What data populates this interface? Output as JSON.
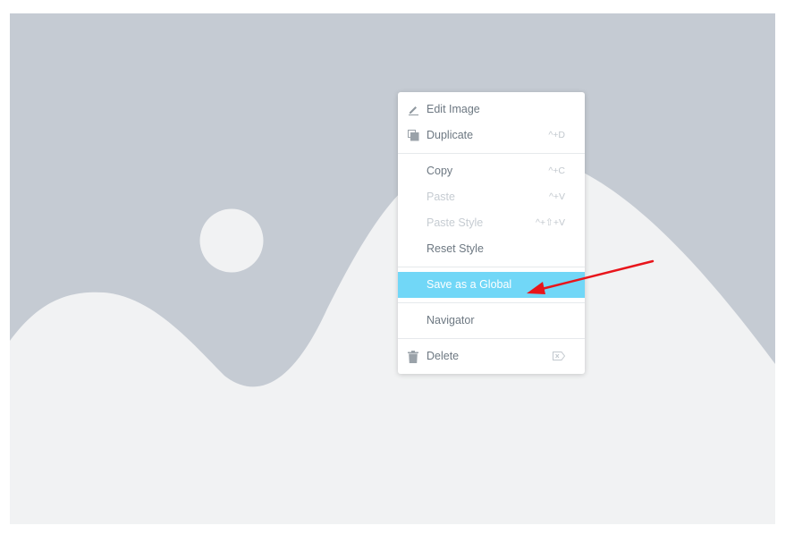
{
  "colors": {
    "canvas_background": "#ffffff",
    "placeholder_sky": "#c5cbd3",
    "placeholder_foreground": "#f1f2f3",
    "menu_text": "#6d7882",
    "menu_disabled": "#c6ccd2",
    "highlight": "#71d7f7",
    "annotation_arrow": "#e8151b"
  },
  "context_menu": {
    "groups": [
      [
        {
          "label": "Edit Image",
          "icon": "pencil-icon",
          "shortcut": "",
          "disabled": false
        },
        {
          "label": "Duplicate",
          "icon": "duplicate-icon",
          "shortcut": "^+D",
          "disabled": false
        }
      ],
      [
        {
          "label": "Copy",
          "icon": "",
          "shortcut": "^+C",
          "disabled": false
        },
        {
          "label": "Paste",
          "icon": "",
          "shortcut": "^+V",
          "disabled": true
        },
        {
          "label": "Paste Style",
          "icon": "",
          "shortcut": "^+⇧+V",
          "disabled": true
        },
        {
          "label": "Reset Style",
          "icon": "",
          "shortcut": "",
          "disabled": false
        }
      ],
      [
        {
          "label": "Save as a Global",
          "icon": "",
          "shortcut": "",
          "disabled": false,
          "highlighted": true
        }
      ],
      [
        {
          "label": "Navigator",
          "icon": "",
          "shortcut": "",
          "disabled": false
        }
      ],
      [
        {
          "label": "Delete",
          "icon": "trash-icon",
          "shortcut": "⌦",
          "shortcut_icon": "backspace-key-icon",
          "disabled": false
        }
      ]
    ]
  }
}
